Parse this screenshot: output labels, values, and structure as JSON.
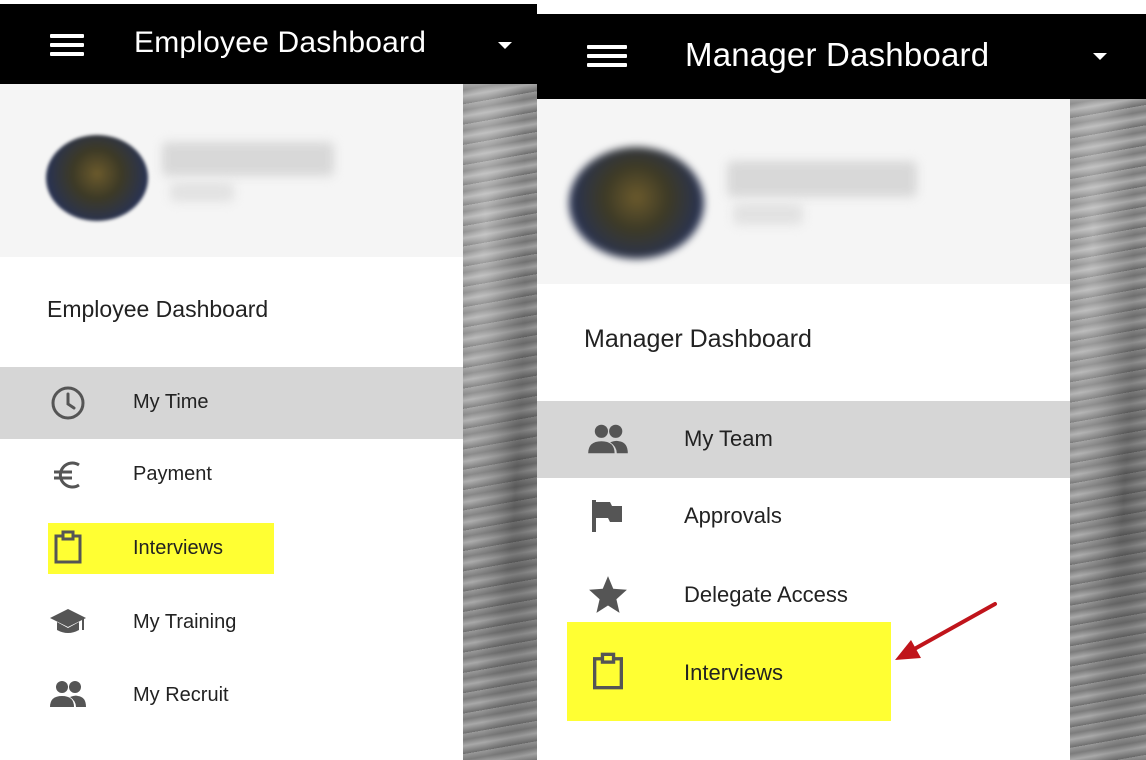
{
  "employee": {
    "topbar_title": "Employee Dashboard",
    "drawer_heading": "Employee Dashboard",
    "nav": [
      {
        "label": "My Time",
        "icon": "clock-icon",
        "active": true
      },
      {
        "label": "Payment",
        "icon": "euro-icon",
        "active": false
      },
      {
        "label": "Interviews",
        "icon": "clipboard-icon",
        "active": false,
        "highlighted": true
      },
      {
        "label": "My Training",
        "icon": "graduation-cap-icon",
        "active": false
      },
      {
        "label": "My Recruit",
        "icon": "people-icon",
        "active": false
      }
    ]
  },
  "manager": {
    "topbar_title": "Manager Dashboard",
    "drawer_heading": "Manager Dashboard",
    "nav": [
      {
        "label": "My Team",
        "icon": "people-icon",
        "active": true
      },
      {
        "label": "Approvals",
        "icon": "flag-icon",
        "active": false
      },
      {
        "label": "Delegate Access",
        "icon": "star-icon",
        "active": false
      },
      {
        "label": "Interviews",
        "icon": "clipboard-icon",
        "active": false,
        "highlighted": true
      }
    ]
  },
  "colors": {
    "topbar": "#000000",
    "active_item": "#d6d6d6",
    "highlight": "#ffff33",
    "annotation_arrow": "#c0141b",
    "icon": "#555555"
  }
}
